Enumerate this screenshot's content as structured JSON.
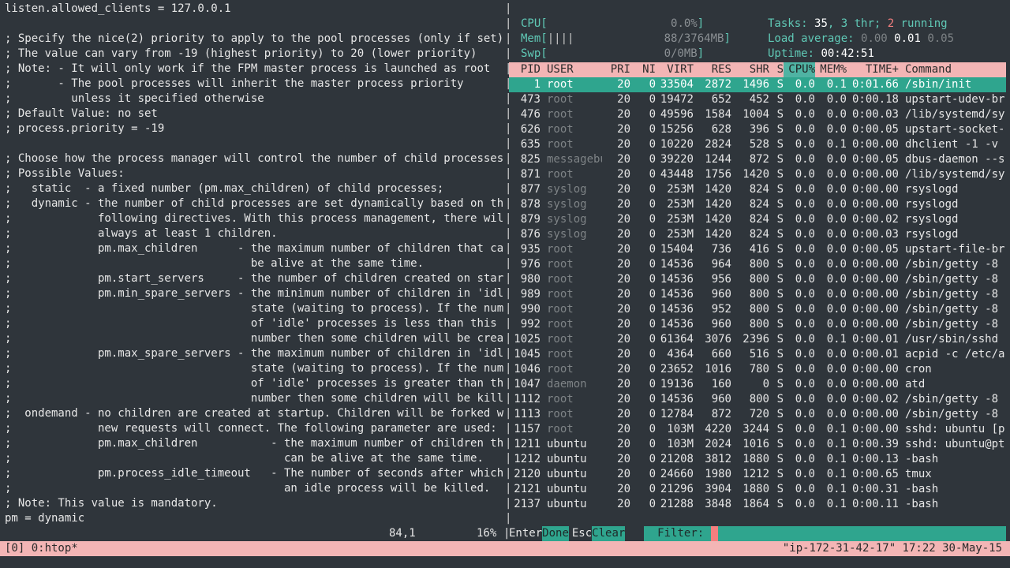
{
  "editor": {
    "lines": [
      "listen.allowed_clients = 127.0.0.1",
      "",
      "; Specify the nice(2) priority to apply to the pool processes (only if set)",
      "; The value can vary from -19 (highest priority) to 20 (lower priority)",
      "; Note: - It will only work if the FPM master process is launched as root",
      ";       - The pool processes will inherit the master process priority",
      ";         unless it specified otherwise",
      "; Default Value: no set",
      "; process.priority = -19",
      "",
      "; Choose how the process manager will control the number of child processes.",
      "; Possible Values:",
      ";   static  - a fixed number (pm.max_children) of child processes;",
      ";   dynamic - the number of child processes are set dynamically based on the",
      ";             following directives. With this process management, there will be",
      ";             always at least 1 children.",
      ";             pm.max_children      - the maximum number of children that can",
      ";                                    be alive at the same time.",
      ";             pm.start_servers     - the number of children created on startup.",
      ";             pm.min_spare_servers - the minimum number of children in 'idle'",
      ";                                    state (waiting to process). If the number",
      ";                                    of 'idle' processes is less than this",
      ";                                    number then some children will be created.",
      ";             pm.max_spare_servers - the maximum number of children in 'idle'",
      ";                                    state (waiting to process). If the number",
      ";                                    of 'idle' processes is greater than this",
      ";                                    number then some children will be killed.",
      ";  ondemand - no children are created at startup. Children will be forked when",
      ";             new requests will connect. The following parameter are used:",
      ";             pm.max_children           - the maximum number of children that",
      ";                                         can be alive at the same time.",
      ";             pm.process_idle_timeout   - The number of seconds after which",
      ";                                         an idle process will be killed.",
      "; Note: This value is mandatory.",
      "pm = dynamic"
    ],
    "cursor_pos": "84,1",
    "scroll_pct": "16%",
    "separator": "|"
  },
  "htop": {
    "meters": {
      "cpu": {
        "label": "CPU",
        "bar": "",
        "value": "0.0%"
      },
      "mem": {
        "label": "Mem",
        "bar": "||||",
        "value": "88/3764MB"
      },
      "swp": {
        "label": "Swp",
        "bar": "",
        "value": "0/0MB"
      }
    },
    "tasks": {
      "label": "Tasks: ",
      "count": "35",
      "threads": ", 3 thr; ",
      "running": "2",
      "running_label": " running"
    },
    "load": {
      "label": "Load average: ",
      "l1": "0.00",
      "l5": "0.01",
      "l15": "0.05"
    },
    "uptime": {
      "label": "Uptime: ",
      "value": "00:42:51"
    },
    "columns": [
      "PID",
      "USER",
      "PRI",
      "NI",
      "VIRT",
      "RES",
      "SHR",
      "S",
      "CPU%",
      "MEM%",
      "TIME+",
      "Command"
    ],
    "processes": [
      [
        "1",
        "root",
        "20",
        "0",
        "33504",
        "2872",
        "1496",
        "S",
        "0.0",
        "0.1",
        "0:01.66",
        "/sbin/init"
      ],
      [
        "473",
        "root",
        "20",
        "0",
        "19472",
        "652",
        "452",
        "S",
        "0.0",
        "0.0",
        "0:00.18",
        "upstart-udev-br"
      ],
      [
        "476",
        "root",
        "20",
        "0",
        "49596",
        "1584",
        "1004",
        "S",
        "0.0",
        "0.0",
        "0:00.03",
        "/lib/systemd/sy"
      ],
      [
        "626",
        "root",
        "20",
        "0",
        "15256",
        "628",
        "396",
        "S",
        "0.0",
        "0.0",
        "0:00.05",
        "upstart-socket-"
      ],
      [
        "635",
        "root",
        "20",
        "0",
        "10220",
        "2824",
        "528",
        "S",
        "0.0",
        "0.1",
        "0:00.00",
        "dhclient -1 -v"
      ],
      [
        "825",
        "messagebu",
        "20",
        "0",
        "39220",
        "1244",
        "872",
        "S",
        "0.0",
        "0.0",
        "0:00.05",
        "dbus-daemon --s"
      ],
      [
        "871",
        "root",
        "20",
        "0",
        "43448",
        "1756",
        "1420",
        "S",
        "0.0",
        "0.0",
        "0:00.00",
        "/lib/systemd/sy"
      ],
      [
        "877",
        "syslog",
        "20",
        "0",
        "253M",
        "1420",
        "824",
        "S",
        "0.0",
        "0.0",
        "0:00.00",
        "rsyslogd"
      ],
      [
        "878",
        "syslog",
        "20",
        "0",
        "253M",
        "1420",
        "824",
        "S",
        "0.0",
        "0.0",
        "0:00.00",
        "rsyslogd"
      ],
      [
        "879",
        "syslog",
        "20",
        "0",
        "253M",
        "1420",
        "824",
        "S",
        "0.0",
        "0.0",
        "0:00.02",
        "rsyslogd"
      ],
      [
        "876",
        "syslog",
        "20",
        "0",
        "253M",
        "1420",
        "824",
        "S",
        "0.0",
        "0.0",
        "0:00.03",
        "rsyslogd"
      ],
      [
        "935",
        "root",
        "20",
        "0",
        "15404",
        "736",
        "416",
        "S",
        "0.0",
        "0.0",
        "0:00.05",
        "upstart-file-br"
      ],
      [
        "976",
        "root",
        "20",
        "0",
        "14536",
        "964",
        "800",
        "S",
        "0.0",
        "0.0",
        "0:00.00",
        "/sbin/getty -8"
      ],
      [
        "980",
        "root",
        "20",
        "0",
        "14536",
        "956",
        "800",
        "S",
        "0.0",
        "0.0",
        "0:00.00",
        "/sbin/getty -8"
      ],
      [
        "989",
        "root",
        "20",
        "0",
        "14536",
        "960",
        "800",
        "S",
        "0.0",
        "0.0",
        "0:00.00",
        "/sbin/getty -8"
      ],
      [
        "990",
        "root",
        "20",
        "0",
        "14536",
        "952",
        "800",
        "S",
        "0.0",
        "0.0",
        "0:00.00",
        "/sbin/getty -8"
      ],
      [
        "992",
        "root",
        "20",
        "0",
        "14536",
        "960",
        "800",
        "S",
        "0.0",
        "0.0",
        "0:00.00",
        "/sbin/getty -8"
      ],
      [
        "1025",
        "root",
        "20",
        "0",
        "61364",
        "3076",
        "2396",
        "S",
        "0.0",
        "0.1",
        "0:00.01",
        "/usr/sbin/sshd"
      ],
      [
        "1045",
        "root",
        "20",
        "0",
        "4364",
        "660",
        "516",
        "S",
        "0.0",
        "0.0",
        "0:00.01",
        "acpid -c /etc/a"
      ],
      [
        "1046",
        "root",
        "20",
        "0",
        "23652",
        "1016",
        "780",
        "S",
        "0.0",
        "0.0",
        "0:00.00",
        "cron"
      ],
      [
        "1047",
        "daemon",
        "20",
        "0",
        "19136",
        "160",
        "0",
        "S",
        "0.0",
        "0.0",
        "0:00.00",
        "atd"
      ],
      [
        "1112",
        "root",
        "20",
        "0",
        "14536",
        "960",
        "800",
        "S",
        "0.0",
        "0.0",
        "0:00.02",
        "/sbin/getty -8"
      ],
      [
        "1113",
        "root",
        "20",
        "0",
        "12784",
        "872",
        "720",
        "S",
        "0.0",
        "0.0",
        "0:00.00",
        "/sbin/getty -8"
      ],
      [
        "1157",
        "root",
        "20",
        "0",
        "103M",
        "4220",
        "3244",
        "S",
        "0.0",
        "0.1",
        "0:00.00",
        "sshd: ubuntu [p"
      ],
      [
        "1211",
        "ubuntu",
        "20",
        "0",
        "103M",
        "2024",
        "1016",
        "S",
        "0.0",
        "0.1",
        "0:00.39",
        "sshd: ubuntu@pt"
      ],
      [
        "1212",
        "ubuntu",
        "20",
        "0",
        "21208",
        "3812",
        "1880",
        "S",
        "0.0",
        "0.1",
        "0:00.13",
        "-bash"
      ],
      [
        "2120",
        "ubuntu",
        "20",
        "0",
        "24660",
        "1980",
        "1212",
        "S",
        "0.0",
        "0.1",
        "0:00.65",
        "tmux"
      ],
      [
        "2121",
        "ubuntu",
        "20",
        "0",
        "21296",
        "3904",
        "1880",
        "S",
        "0.0",
        "0.1",
        "0:00.31",
        "-bash"
      ],
      [
        "2137",
        "ubuntu",
        "20",
        "0",
        "21288",
        "3848",
        "1864",
        "S",
        "0.0",
        "0.1",
        "0:00.11",
        "-bash"
      ]
    ],
    "selected_index": 0,
    "footer": {
      "enter_key": "Enter",
      "done_label": "Done",
      "esc_key": "Esc",
      "clear_label": "Clear",
      "filter_label": "  Filter: "
    }
  },
  "tmux": {
    "window": "[0] 0:htop*",
    "status": "\"ip-172-31-42-17\" 17:22 30-May-15"
  },
  "colors": {
    "background": "#2f353b",
    "teal": "#2fa58e",
    "pink": "#f3b5b5",
    "accent_red": "#f47f7f"
  }
}
